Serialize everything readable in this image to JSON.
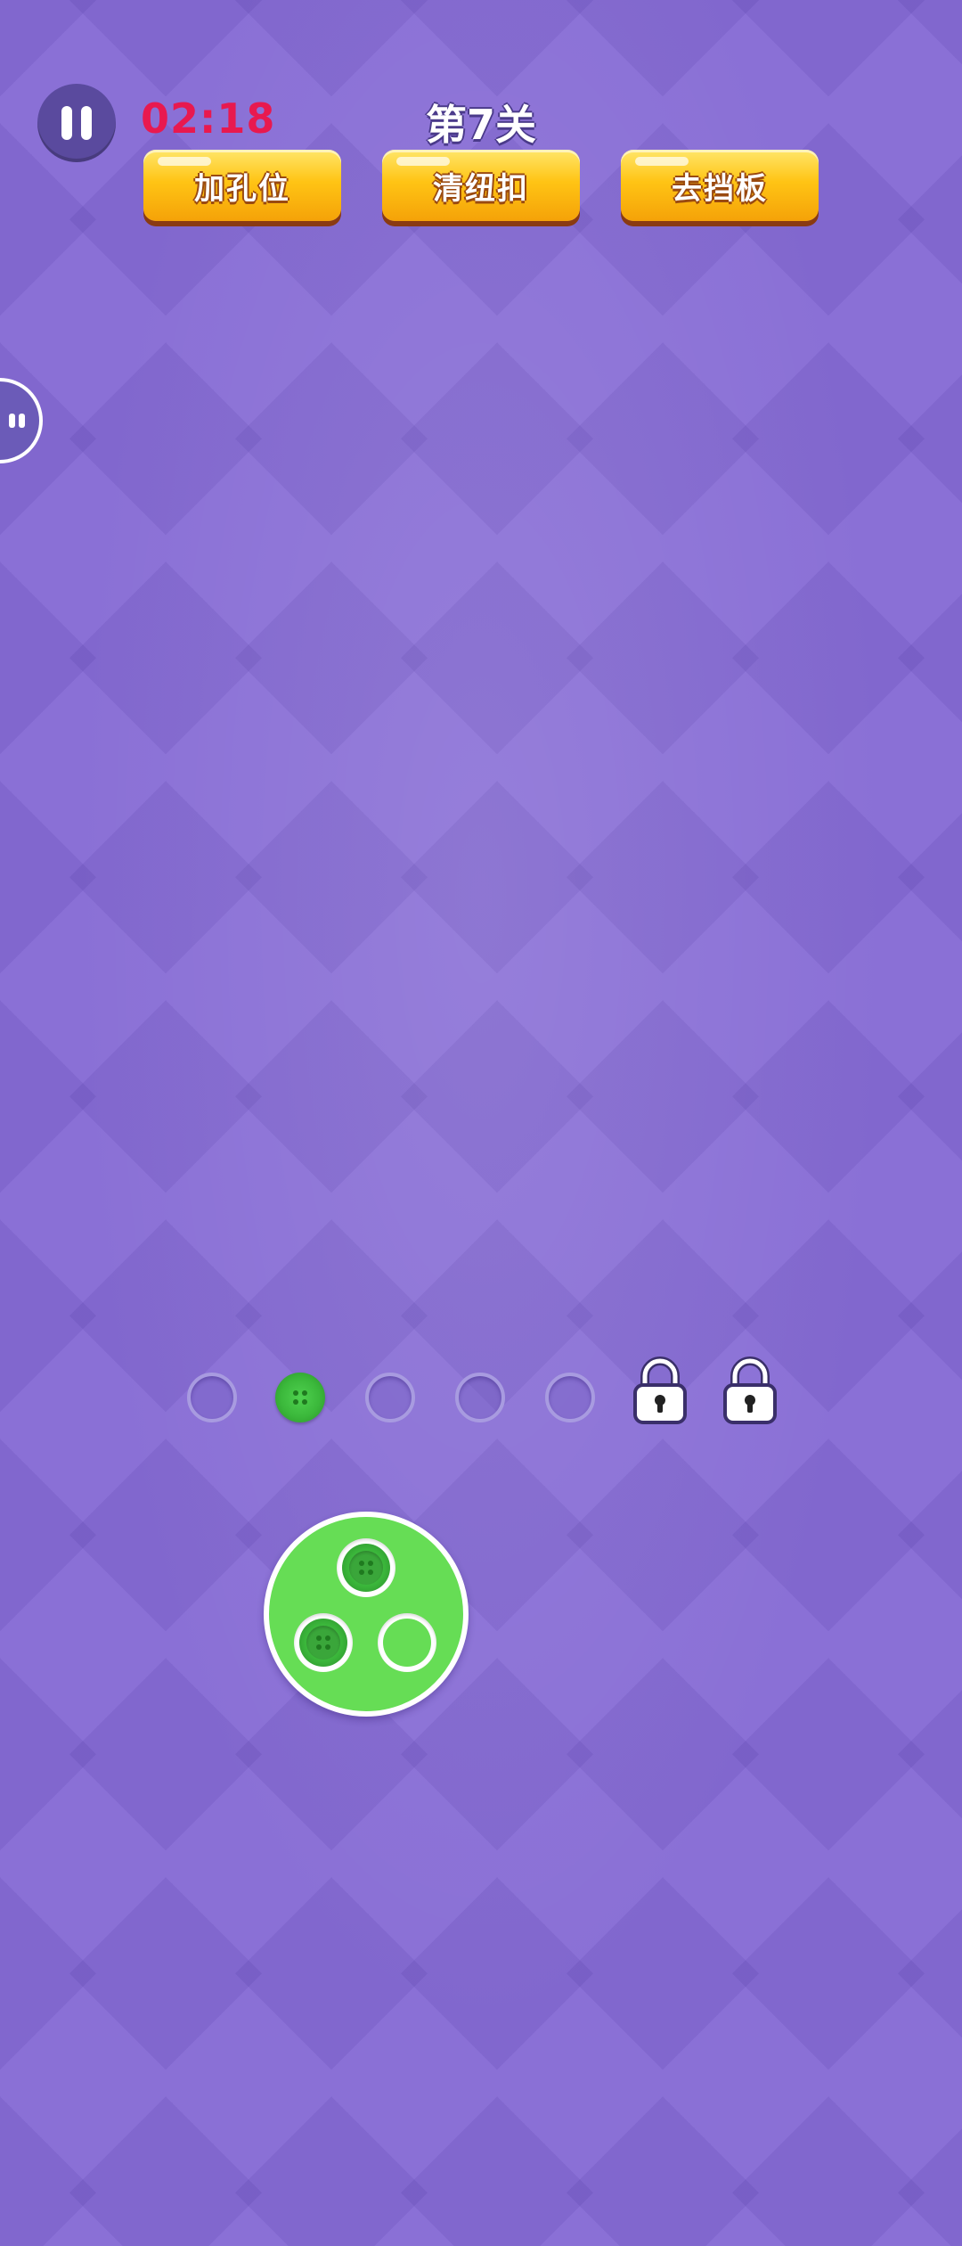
{
  "hud": {
    "timer": "02:18",
    "level_title": "第7关",
    "pause_icon": "pause-icon"
  },
  "tools": [
    {
      "label": "加孔位"
    },
    {
      "label": "清纽扣"
    },
    {
      "label": "去挡板"
    }
  ],
  "slot_row": {
    "slots": [
      {
        "state": "empty"
      },
      {
        "state": "filled",
        "color": "green"
      },
      {
        "state": "empty"
      },
      {
        "state": "empty"
      },
      {
        "state": "empty"
      },
      {
        "state": "locked"
      },
      {
        "state": "locked"
      }
    ]
  },
  "plate": {
    "color": "#66dd55",
    "holes": [
      {
        "state": "button",
        "color": "green"
      },
      {
        "state": "button",
        "color": "green"
      },
      {
        "state": "empty"
      }
    ]
  },
  "colors": {
    "background": "#8a70d6",
    "timer": "#e8194f",
    "tool_button": "#ffc414",
    "button_green": "#3bb83b"
  }
}
